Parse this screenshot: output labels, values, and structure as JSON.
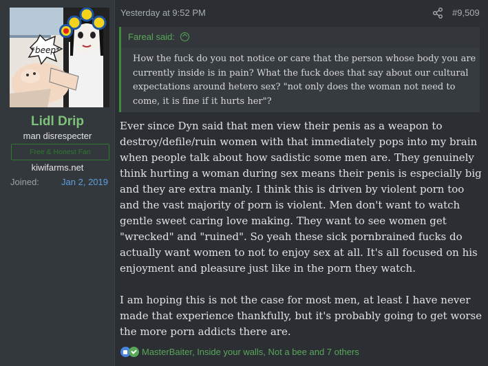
{
  "user": {
    "name": "Lidl Drip",
    "title": "man disrespecter",
    "banner": "Free & Honest Fan",
    "site": "kiwifarms.net",
    "joined_label": "Joined:",
    "joined_date": "Jan 2, 2019",
    "avatar_speech": "*beep*"
  },
  "post": {
    "date": "Yesterday at 9:52 PM",
    "number": "#9,509",
    "quote": {
      "author": "Fareal said:",
      "text": "How the fuck do you not notice or care that the person whose body you are currently inside is in pain? What the fuck does that say about our cultural expectations around hetero sex? \"not only does the woman not need to come, it is fine if it hurts her\"?"
    },
    "paragraphs": [
      "Ever since Dyn said that men view their penis as a weapon to destroy/defile/ruin women with that immediately pops into my brain when people talk about how sadistic some men are. They genuinely think hurting a woman during sex means their penis is especially big and they are extra manly. I think this is driven by violent porn too and the vast majority of porn is violent. Men don't want to watch gentle sweet caring love making. They want to see women get \"wrecked\" and \"ruined\". So yeah these sick pornbrained fucks do actually want women to not to enjoy sex at all. It's all focused on his enjoyment and pleasure just like in the porn they watch.",
      "I am hoping this is not the case for most men, at least I have never made that experience thankfully, but it's probably going to get worse the more porn addicts there are."
    ],
    "reactions": "MasterBaiter, Inside your walls, Not a bee and 7 others"
  },
  "icons": {
    "share": "share-icon",
    "quote_jump": "arrow-up-circle-icon",
    "like": "like-icon",
    "agree": "agree-icon"
  },
  "colors": {
    "username": "#7ec27a",
    "link": "#5f9fe0",
    "quote_accent": "#3f8a3f",
    "background": "#2b2f33"
  }
}
